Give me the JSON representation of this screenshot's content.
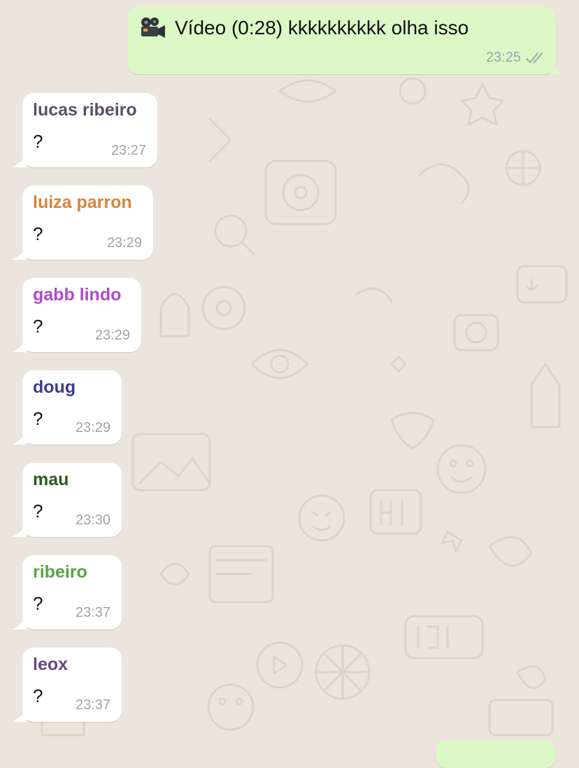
{
  "colors": {
    "incoming_bubble": "#ffffff",
    "outgoing_bubble": "#dcf8c6",
    "background": "#ece5dd",
    "time": "#a3a3a3"
  },
  "outgoing": {
    "icon": "video-camera-icon",
    "text": "Vídeo (0:28) kkkkkkkkkk olha isso",
    "time": "23:25",
    "status_icon": "double-check-icon"
  },
  "messages": [
    {
      "sender": "lucas ribeiro",
      "sender_color": "#5b4f68",
      "text": "?",
      "time": "23:27"
    },
    {
      "sender": "luiza parron",
      "sender_color": "#d8833b",
      "text": "?",
      "time": "23:29"
    },
    {
      "sender": "gabb lindo",
      "sender_color": "#b04ac9",
      "text": "?",
      "time": "23:29"
    },
    {
      "sender": "doug",
      "sender_color": "#3c3f8f",
      "text": "?",
      "time": "23:29"
    },
    {
      "sender": "mau",
      "sender_color": "#2d5a1f",
      "text": "?",
      "time": "23:30"
    },
    {
      "sender": "ribeiro",
      "sender_color": "#56a447",
      "text": "?",
      "time": "23:37"
    },
    {
      "sender": "leox",
      "sender_color": "#6a4580",
      "text": "?",
      "time": "23:37"
    }
  ]
}
